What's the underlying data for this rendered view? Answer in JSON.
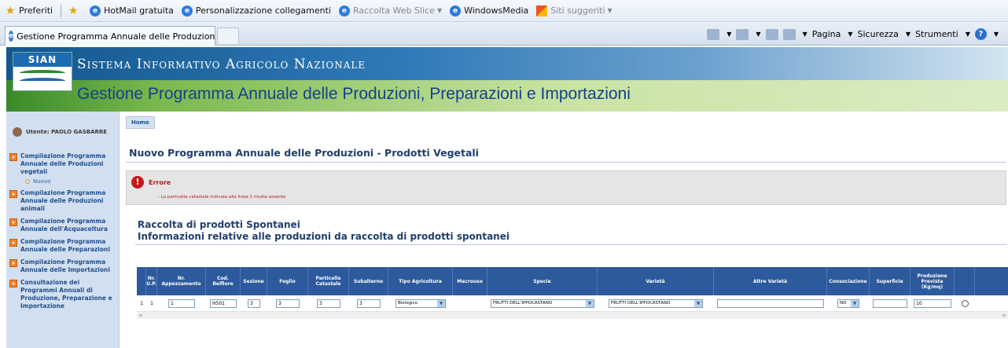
{
  "browser": {
    "favorites_bar": {
      "favorites_label": "Preferiti",
      "links": [
        "HotMail gratuita",
        "Personalizzazione collegamenti",
        "Raccolta Web Slice",
        "WindowsMedia",
        "Siti suggeriti"
      ]
    },
    "tab_title": "Gestione Programma Annuale delle Produzioni, Prepar...",
    "command_bar": {
      "page_label": "Pagina",
      "security_label": "Sicurezza",
      "tools_label": "Strumenti"
    }
  },
  "banner": {
    "logo_text": "SIAN",
    "system_title": "Sistema Informativo Agricolo Nazionale",
    "app_title": "Gestione Programma Annuale delle Produzioni, Preparazioni e Importazioni"
  },
  "sidebar": {
    "user_label": "Utente: PAOLO GASBARRE",
    "items": [
      {
        "label": "Compilazione Programma Annuale delle Produzioni vegetali"
      },
      {
        "label": "Compilazione Programma Annuale delle Produzioni animali"
      },
      {
        "label": "Compilazione Programma Annuale dell'Acquacoltura"
      },
      {
        "label": "Compilazione Programma Annuale delle Preparazioni"
      },
      {
        "label": "Compilazione Programma Annuale delle Importazioni"
      },
      {
        "label": "Consultazione dei Programmi Annuali di Produzione, Preparazione e Importazione"
      }
    ],
    "sub_item_label": "Nuovo"
  },
  "main": {
    "home_label": "Home",
    "page_title": "Nuovo Programma Annuale delle Produzioni - Prodotti Vegetali",
    "error": {
      "title": "Errore",
      "message": "- La particella catastale indicata alla linea 1 risulta assente"
    },
    "section_title": "Raccolta di prodotti Spontanei",
    "section_subtitle": "Informazioni relative alle produzioni da raccolta di prodotti spontanei"
  },
  "table": {
    "headers": [
      "Nr. U.P.",
      "Nr. Appezzamento",
      "Cod. Belfiore",
      "Sezione",
      "Foglio",
      "Particella Catastale",
      "Subalterno",
      "Tipo Agricoltura",
      "Macrouso",
      "Specie",
      "Varietà",
      "Altre Varietà",
      "Consociazione",
      "Superficie",
      "Produzione Prevista (Kg/mq)"
    ],
    "row": {
      "row_num": "1",
      "nr_up": "1",
      "nr_appezzamento": "1",
      "cod_belfiore": "H501",
      "sezione": "3",
      "foglio": "3",
      "particella": "3",
      "subalterno": "3",
      "tipo_agricoltura": "Biologico",
      "specie": "FRUTTI DELL'IPPOCASTANO",
      "varieta": "FRUTTI DELL'IPPOCASTANO",
      "altre_varieta": "",
      "consociazione": "NO",
      "superficie": "",
      "produzione": "10"
    }
  }
}
